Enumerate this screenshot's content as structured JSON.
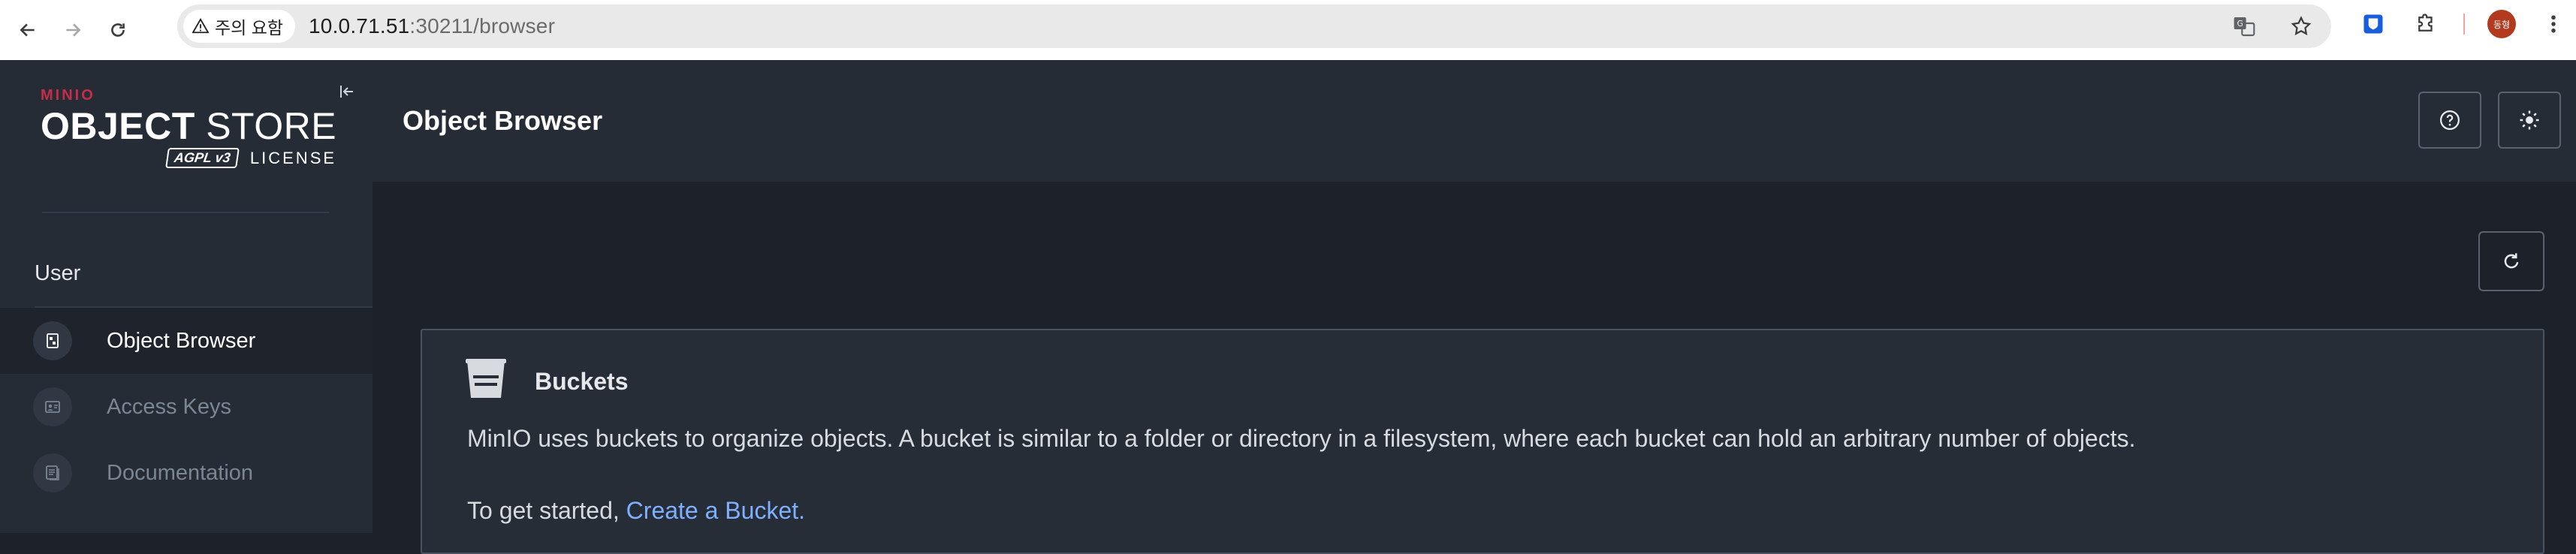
{
  "browser": {
    "security_label": "주의 요함",
    "url_host": "10.0.71.51",
    "url_rest": ":30211/browser",
    "profile_initials": "동형"
  },
  "sidebar": {
    "logo_brand": "MINIO",
    "logo_title_bold": "OBJECT",
    "logo_title_thin": " STORE",
    "logo_badge": "AGPL v3",
    "logo_license": "LICENSE",
    "section_label": "User",
    "items": [
      {
        "label": "Object Browser",
        "icon": "object-browser-icon",
        "active": true
      },
      {
        "label": "Access Keys",
        "icon": "access-keys-icon",
        "active": false
      },
      {
        "label": "Documentation",
        "icon": "documentation-icon",
        "active": false
      }
    ]
  },
  "header": {
    "title": "Object Browser"
  },
  "main": {
    "panel": {
      "title": "Buckets",
      "description": "MinIO uses buckets to organize objects. A bucket is similar to a folder or directory in a filesystem, where each bucket can hold an arbitrary number of objects.",
      "cta_prefix": "To get started, ",
      "cta_link": "Create a Bucket."
    }
  },
  "colors": {
    "sidebar_bg": "#262c36",
    "content_bg": "#1d222a",
    "link": "#7fb0ff",
    "brand_red": "#c72c48"
  }
}
